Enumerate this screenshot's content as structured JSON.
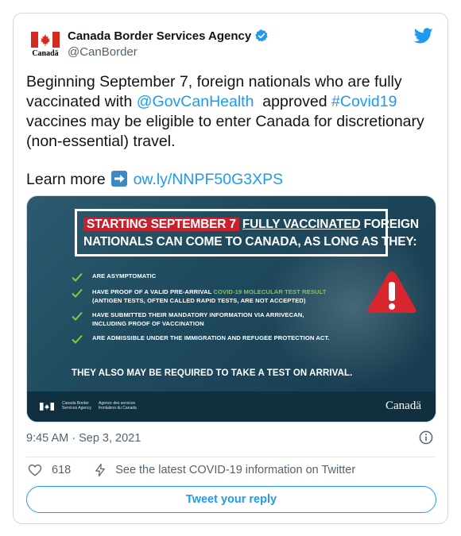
{
  "account": {
    "name": "Canada Border Services Agency",
    "handle": "@CanBorder",
    "avatar_wordmark": "Canadä"
  },
  "tweet": {
    "text_part1": "Beginning September 7, foreign nationals who are fully vaccinated with ",
    "mention": "@GovCanHealth",
    "text_part2": "  approved ",
    "hashtag": "#Covid19",
    "text_part3": " vaccines may be eligible to enter Canada for discretionary (non-essential) travel.",
    "learn_more": "Learn more ",
    "link": "ow.ly/NNPF50G3XPS"
  },
  "media": {
    "headline_red": "STARTING SEPTEMBER 7",
    "headline_underlined": "FULLY VACCINATED",
    "headline_rest1": " FOREIGN",
    "headline_line2": "NATIONALS CAN COME TO CANADA, AS LONG AS THEY:",
    "items": [
      {
        "text_a": "ARE ASYMPTOMATIC"
      },
      {
        "text_a": "HAVE PROOF OF A VALID PRE-ARRIVAL ",
        "highlight": "COVID-19 MOLECULAR TEST RESULT",
        "text_b": "(ANTIGEN TESTS, OFTEN CALLED RAPID TESTS, ARE NOT ACCEPTED)"
      },
      {
        "text_a": "HAVE SUBMITTED THEIR MANDATORY INFORMATION VIA ARRIVECAN,",
        "text_b": "INCLUDING PROOF OF VACCINATION"
      },
      {
        "text_a": "ARE ADMISSIBLE UNDER THE IMMIGRATION AND REFUGEE PROTECTION ACT."
      }
    ],
    "also": "THEY ALSO MAY BE REQUIRED TO TAKE A TEST ON ARRIVAL.",
    "footer_en_1": "Canada Border",
    "footer_en_2": "Services Agency",
    "footer_fr_1": "Agence des services",
    "footer_fr_2": "frontaliers du Canada",
    "footer_wordmark": "Canadä"
  },
  "meta": {
    "timestamp": "9:45 AM · Sep 3, 2021",
    "likes": "618",
    "covid_info": "See the latest COVID-19 information on Twitter",
    "reply_label": "Tweet your reply"
  },
  "colors": {
    "accent": "#1d9bf0",
    "red": "#c8202e",
    "green": "#8dc63f",
    "media_bg": "#1f4a5e"
  },
  "icons": [
    "canada-flag-icon",
    "verified-badge-icon",
    "twitter-bird-icon",
    "arrow-right-icon",
    "checkmark-icon",
    "warning-icon",
    "info-icon",
    "heart-icon",
    "lightning-icon"
  ]
}
